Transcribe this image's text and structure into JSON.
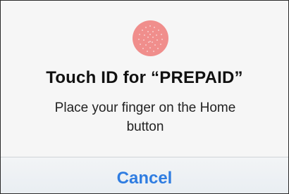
{
  "dialog": {
    "icon": "fingerprint-icon",
    "title": "Touch ID for “PREPAID”",
    "message": "Place your finger on the Home button",
    "cancel_label": "Cancel"
  },
  "colors": {
    "icon_fill": "#f08e8c",
    "accent": "#2f7de1",
    "background": "#f6f6f6"
  }
}
